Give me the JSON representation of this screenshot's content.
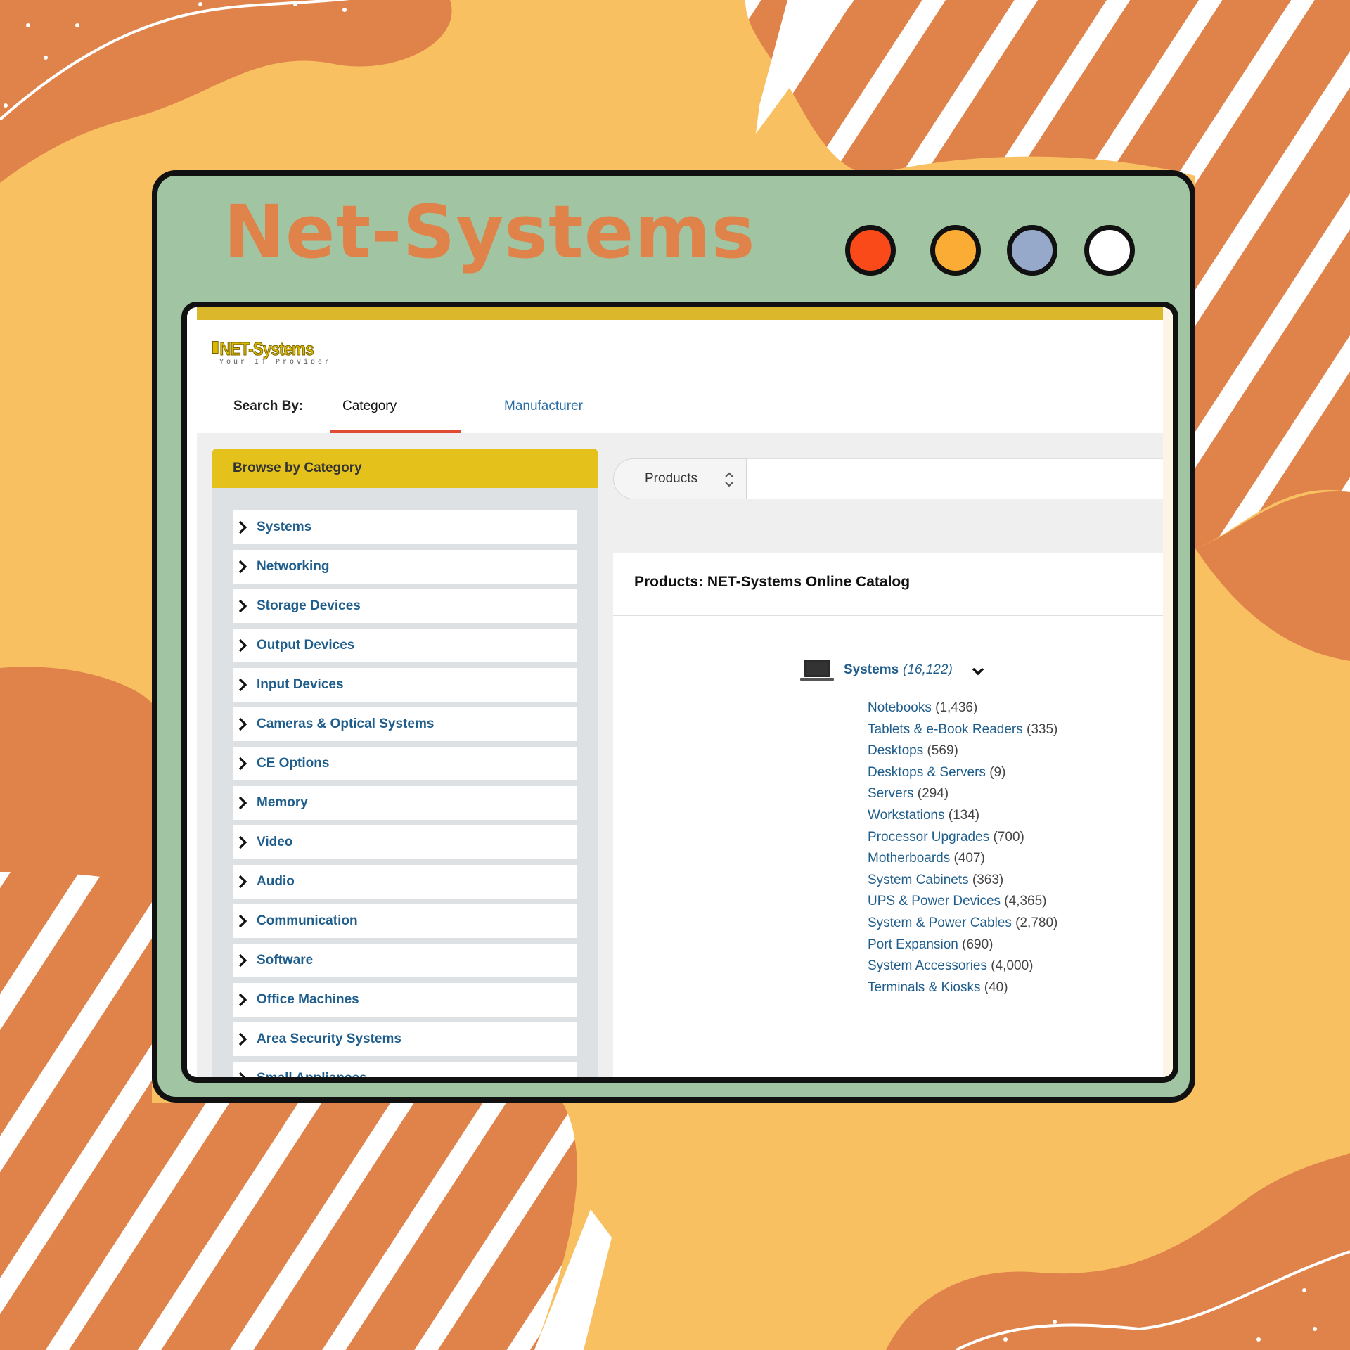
{
  "window": {
    "title": "Net-Systems",
    "dots": [
      {
        "color": "#fa4a1a"
      },
      {
        "color": "#fbac35"
      },
      {
        "color": "#97a9cb"
      },
      {
        "color": "#ffffff"
      }
    ]
  },
  "colors": {
    "background": "#f9c062",
    "wave": "#e0834a",
    "window_frame": "#a1c5a3",
    "accent_bar": "#dbb82b",
    "tab_underline": "#e14b34",
    "link": "#1f5e8c"
  },
  "site": {
    "logo_text": "NET-Systems",
    "logo_tagline": "Your IT Provider"
  },
  "search_by": {
    "label": "Search By:",
    "tabs": [
      {
        "label": "Category",
        "active": true
      },
      {
        "label": "Manufacturer",
        "active": false
      }
    ]
  },
  "sidebar": {
    "header": "Browse by Category",
    "items": [
      {
        "label": "Systems",
        "icon": "chevron-right-icon"
      },
      {
        "label": "Networking",
        "icon": "chevron-right-icon"
      },
      {
        "label": "Storage Devices",
        "icon": "chevron-right-icon"
      },
      {
        "label": "Output Devices",
        "icon": "chevron-right-icon"
      },
      {
        "label": "Input Devices",
        "icon": "chevron-right-icon"
      },
      {
        "label": "Cameras & Optical Systems",
        "icon": "chevron-right-icon"
      },
      {
        "label": "CE Options",
        "icon": "chevron-right-icon"
      },
      {
        "label": "Memory",
        "icon": "chevron-right-icon"
      },
      {
        "label": "Video",
        "icon": "chevron-right-icon"
      },
      {
        "label": "Audio",
        "icon": "chevron-right-icon"
      },
      {
        "label": "Communication",
        "icon": "chevron-right-icon"
      },
      {
        "label": "Software",
        "icon": "chevron-right-icon"
      },
      {
        "label": "Office Machines",
        "icon": "chevron-right-icon"
      },
      {
        "label": "Area Security Systems",
        "icon": "chevron-right-icon"
      },
      {
        "label": "Small Appliances",
        "icon": "chevron-right-icon"
      }
    ]
  },
  "search": {
    "select_value": "Products",
    "input_value": ""
  },
  "catalog": {
    "title": "Products: NET-Systems Online Catalog",
    "group": {
      "name": "Systems",
      "count": "(16,122)",
      "icon": "laptop-icon",
      "expand_icon": "chevron-down-icon",
      "subcategories": [
        {
          "name": "Notebooks",
          "count": "(1,436)"
        },
        {
          "name": "Tablets & e-Book Readers",
          "count": "(335)"
        },
        {
          "name": "Desktops",
          "count": "(569)"
        },
        {
          "name": "Desktops & Servers",
          "count": "(9)"
        },
        {
          "name": "Servers",
          "count": "(294)"
        },
        {
          "name": "Workstations",
          "count": "(134)"
        },
        {
          "name": "Processor Upgrades",
          "count": "(700)"
        },
        {
          "name": "Motherboards",
          "count": "(407)"
        },
        {
          "name": "System Cabinets",
          "count": "(363)"
        },
        {
          "name": "UPS & Power Devices",
          "count": "(4,365)"
        },
        {
          "name": "System & Power Cables",
          "count": "(2,780)"
        },
        {
          "name": "Port Expansion",
          "count": "(690)"
        },
        {
          "name": "System Accessories",
          "count": "(4,000)"
        },
        {
          "name": "Terminals & Kiosks",
          "count": "(40)"
        }
      ]
    }
  }
}
